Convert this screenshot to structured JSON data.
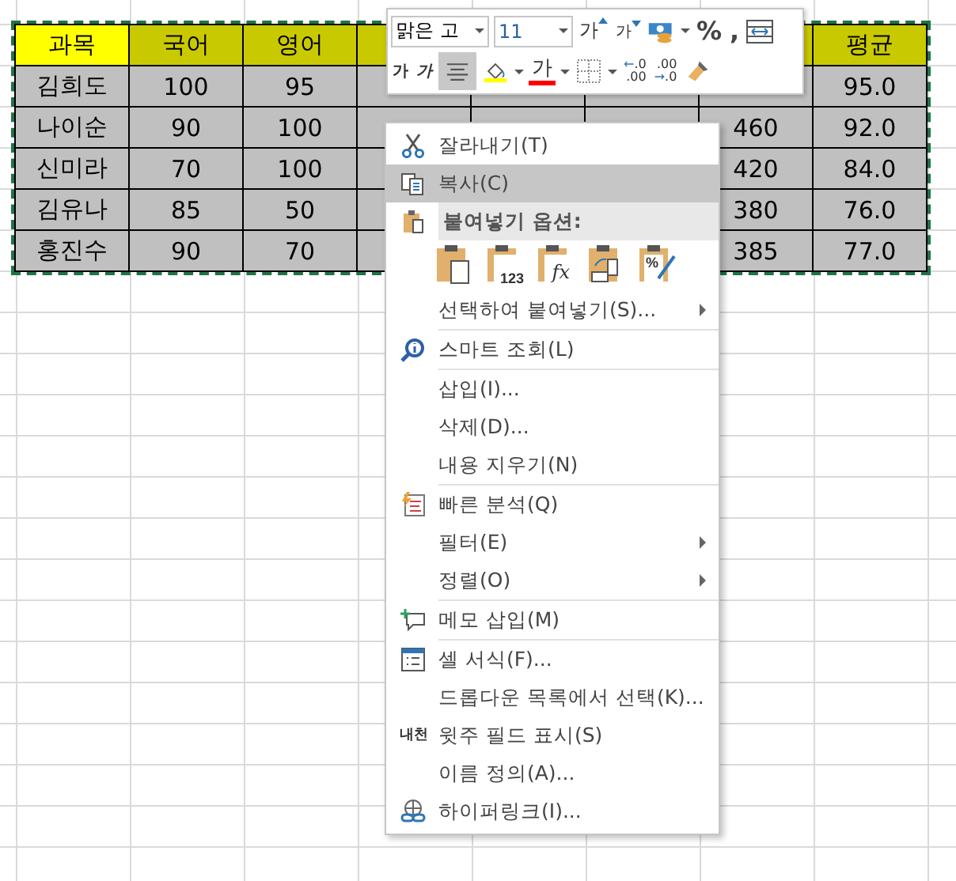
{
  "sheet": {
    "columns": [
      {
        "label": "과목",
        "highlight": true
      },
      {
        "label": "국어",
        "highlight": false
      },
      {
        "label": "영어",
        "highlight": false
      },
      null,
      null,
      null,
      null,
      {
        "label": "평균",
        "highlight": false
      }
    ],
    "rows": [
      [
        "김희도",
        "100",
        "95",
        null,
        null,
        null,
        null,
        "95.0"
      ],
      [
        "나이순",
        "90",
        "100",
        null,
        null,
        null,
        "460",
        "92.0"
      ],
      [
        "신미라",
        "70",
        "100",
        null,
        null,
        null,
        "420",
        "84.0"
      ],
      [
        "김유나",
        "85",
        "50",
        null,
        null,
        null,
        "380",
        "76.0"
      ],
      [
        "홍진수",
        "90",
        "70",
        null,
        null,
        null,
        "385",
        "77.0"
      ]
    ]
  },
  "mini_toolbar": {
    "font": "맑은 고",
    "size": "11",
    "grow_font": "가",
    "shrink_font": "가",
    "percent": "%",
    "comma": ",",
    "bold": "가",
    "italic": "가",
    "align_center_selected": true,
    "font_color_glyph": "가",
    "decrease_decimal": {
      "arrow": "←",
      "top": ".0",
      "bottom": ".00"
    },
    "increase_decimal": {
      "arrow": "→",
      "top": ".00",
      "bottom": ".0"
    }
  },
  "context_menu": {
    "items": [
      {
        "kind": "item",
        "label": "잘라내기(T)",
        "selected": false,
        "submenu": false
      },
      {
        "kind": "item",
        "label": "복사(C)",
        "selected": true,
        "submenu": false
      },
      {
        "kind": "section",
        "label": "붙여넣기 옵션:"
      },
      {
        "kind": "paste-icons",
        "labels": [
          "123",
          "fx",
          "%"
        ]
      },
      {
        "kind": "item",
        "label": "선택하여 붙여넣기(S)...",
        "selected": false,
        "submenu": true
      },
      {
        "kind": "separator"
      },
      {
        "kind": "item",
        "label": "스마트 조회(L)",
        "selected": false,
        "submenu": false
      },
      {
        "kind": "separator"
      },
      {
        "kind": "item",
        "label": "삽입(I)...",
        "selected": false,
        "submenu": false
      },
      {
        "kind": "item",
        "label": "삭제(D)...",
        "selected": false,
        "submenu": false
      },
      {
        "kind": "item",
        "label": "내용 지우기(N)",
        "selected": false,
        "submenu": false
      },
      {
        "kind": "separator"
      },
      {
        "kind": "item",
        "label": "빠른 분석(Q)",
        "selected": false,
        "submenu": false
      },
      {
        "kind": "item",
        "label": "필터(E)",
        "selected": false,
        "submenu": true
      },
      {
        "kind": "item",
        "label": "정렬(O)",
        "selected": false,
        "submenu": true
      },
      {
        "kind": "separator"
      },
      {
        "kind": "item",
        "label": "메모 삽입(M)",
        "selected": false,
        "submenu": false
      },
      {
        "kind": "separator"
      },
      {
        "kind": "item",
        "label": "셀 서식(F)...",
        "selected": false,
        "submenu": false
      },
      {
        "kind": "item",
        "label": "드롭다운 목록에서 선택(K)...",
        "selected": false,
        "submenu": false
      },
      {
        "kind": "item",
        "icon_text": "내천",
        "label": "윗주 필드 표시(S)",
        "selected": false,
        "submenu": false
      },
      {
        "kind": "item",
        "label": "이름 정의(A)...",
        "selected": false,
        "submenu": false
      },
      {
        "kind": "item",
        "label": "하이퍼링크(I)...",
        "selected": false,
        "submenu": false
      }
    ]
  }
}
